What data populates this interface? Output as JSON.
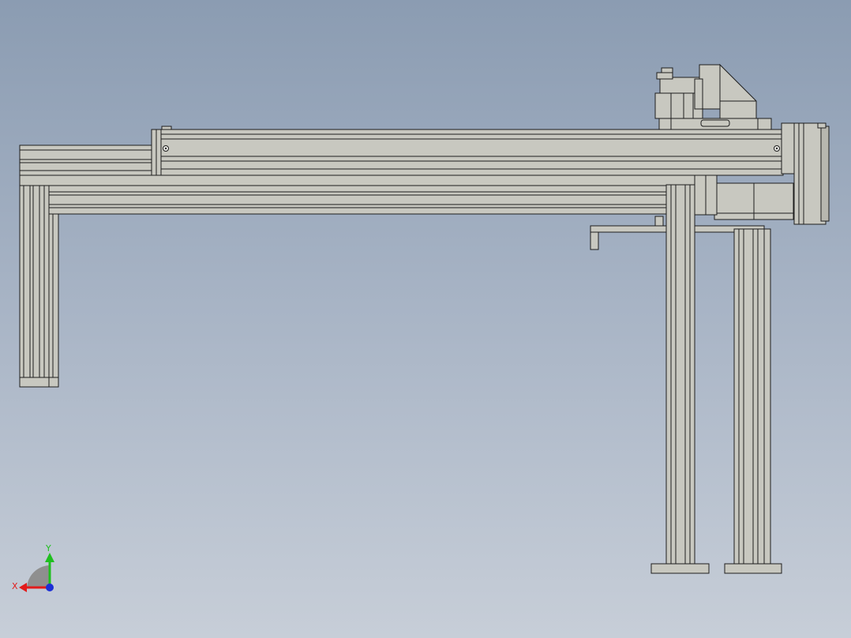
{
  "viewport": {
    "view": "front",
    "background_top": "#8b9cb2",
    "background_bottom": "#c7ced8"
  },
  "model": {
    "part_color": "#c8c8c0",
    "part_shade": "#a9a9a1",
    "edge_color": "#1e1e1e"
  },
  "triad": {
    "x_label": "X",
    "y_label": "Y",
    "x_color": "#e21b1b",
    "y_color": "#1fbf1f",
    "z_color": "#1c2fd6"
  }
}
